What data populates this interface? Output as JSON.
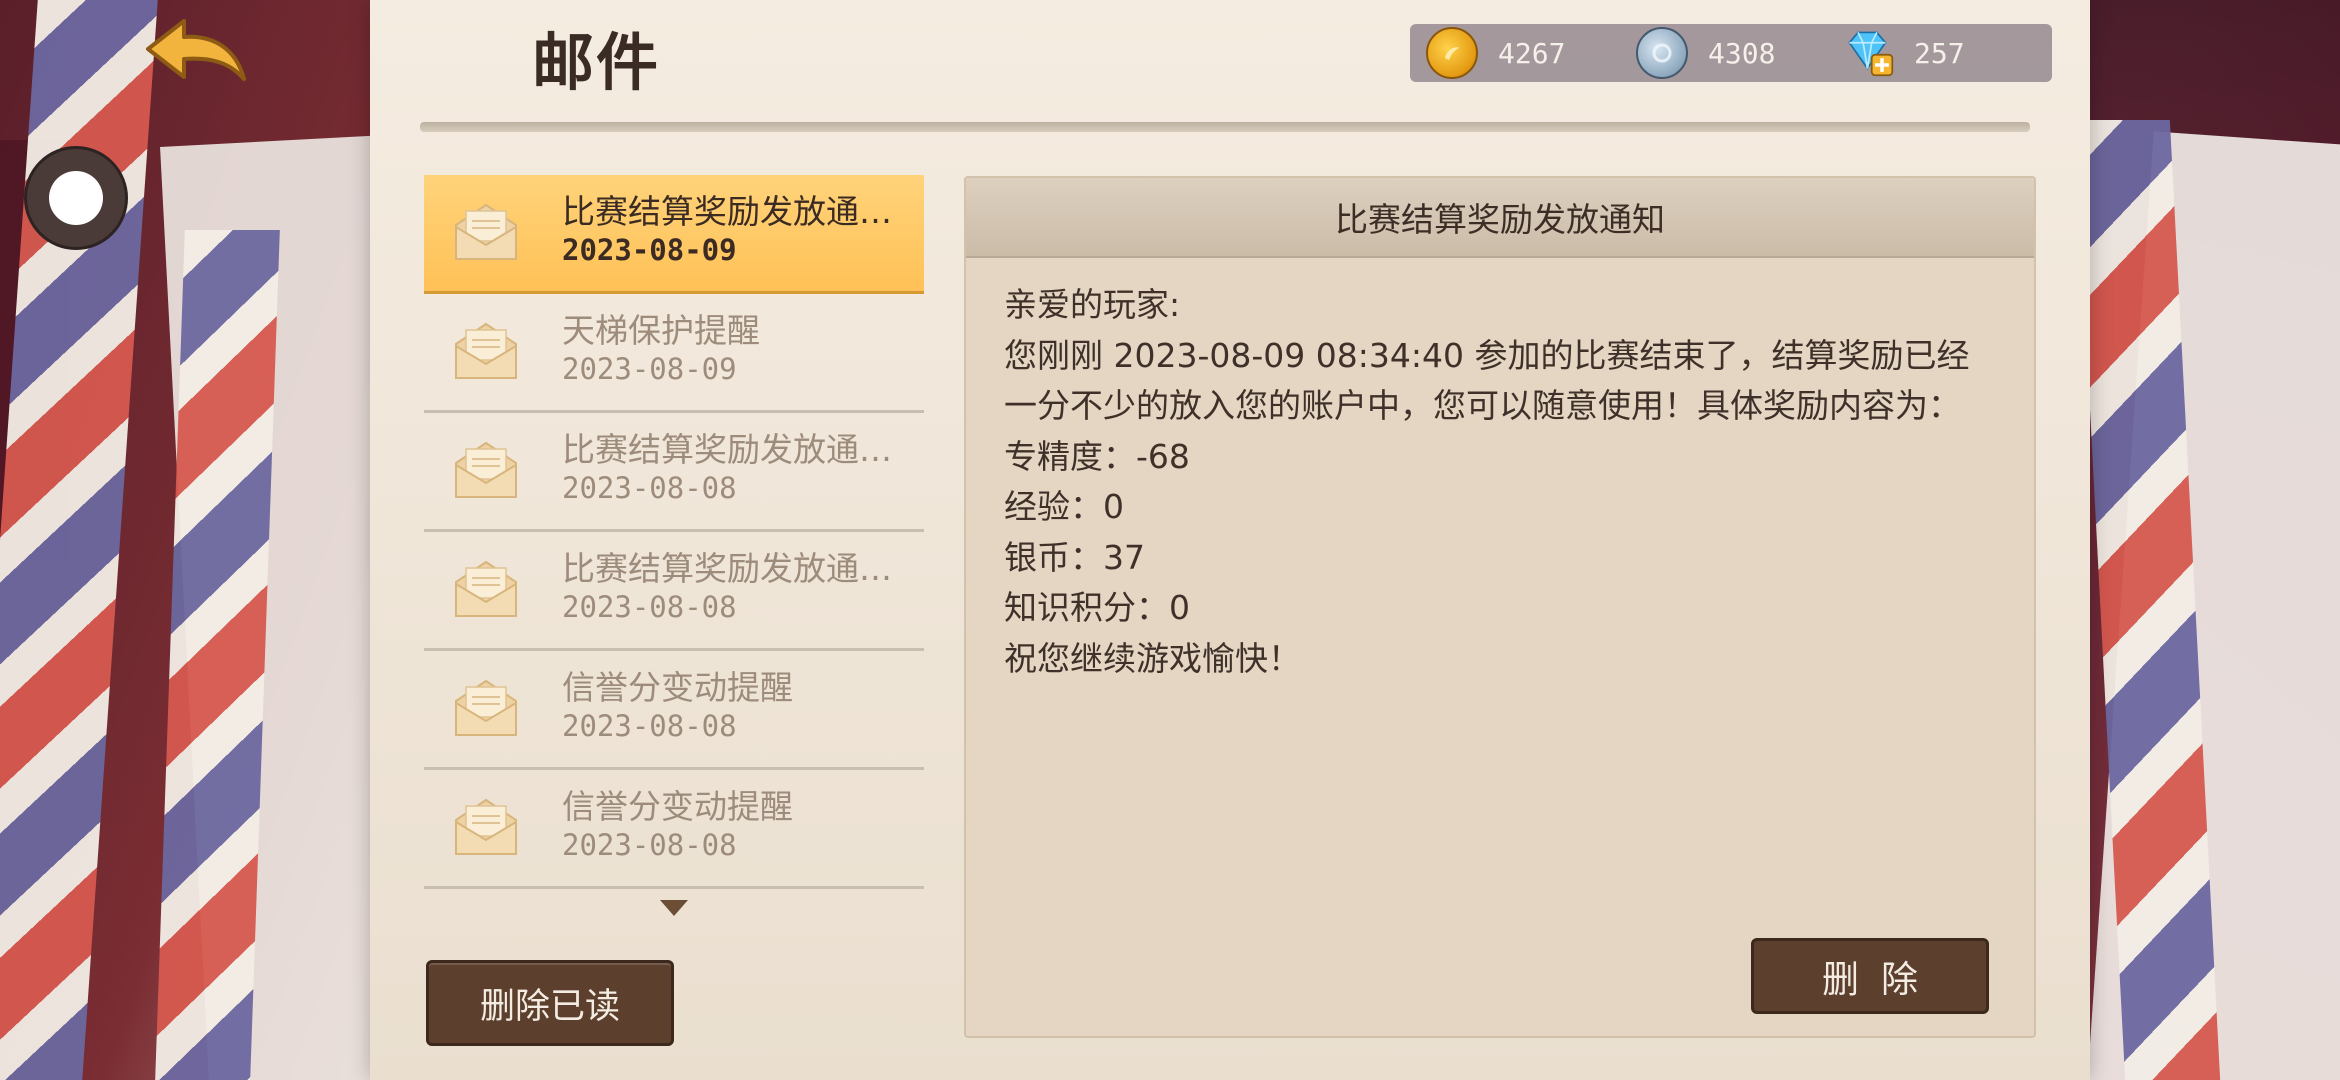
{
  "page": {
    "title": "邮件"
  },
  "currency": {
    "gold": {
      "icon": "gold-coin-icon",
      "value": "4267"
    },
    "silver": {
      "icon": "silver-coin-icon",
      "value": "4308"
    },
    "diamond": {
      "icon": "diamond-plus-icon",
      "value": "257"
    }
  },
  "mail_list": {
    "items": [
      {
        "title": "比赛结算奖励发放通…",
        "date": "2023-08-09",
        "selected": true
      },
      {
        "title": "天梯保护提醒",
        "date": "2023-08-09",
        "selected": false
      },
      {
        "title": "比赛结算奖励发放通…",
        "date": "2023-08-08",
        "selected": false
      },
      {
        "title": "比赛结算奖励发放通…",
        "date": "2023-08-08",
        "selected": false
      },
      {
        "title": "信誉分变动提醒",
        "date": "2023-08-08",
        "selected": false
      },
      {
        "title": "信誉分变动提醒",
        "date": "2023-08-08",
        "selected": false
      }
    ],
    "delete_read_label": "删除已读"
  },
  "detail": {
    "title": "比赛结算奖励发放通知",
    "lines": [
      "亲爱的玩家:",
      "您刚刚 2023-08-09 08:34:40 参加的比赛结束了，结算奖励已经",
      "一分不少的放入您的账户中，您可以随意使用！具体奖励内容为：",
      "专精度：-68",
      "经验：0",
      "银币：37",
      "知识积分：0",
      "祝您继续游戏愉快！"
    ],
    "delete_label": "删除"
  },
  "colors": {
    "selected_row": "#ffc157",
    "button_brown": "#5c3f2d",
    "paper": "#f5ece1"
  }
}
